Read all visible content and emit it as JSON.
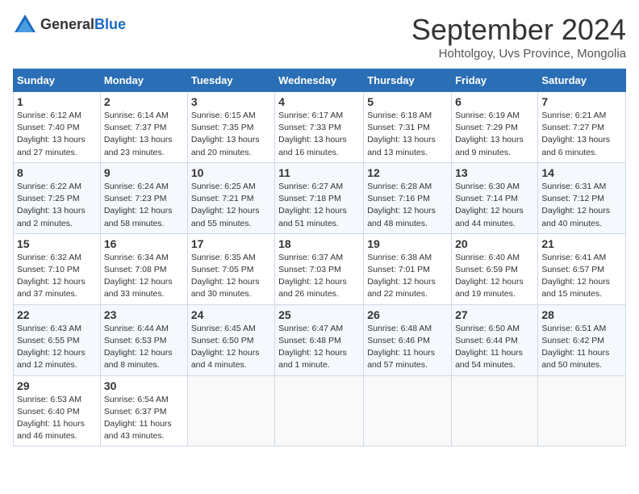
{
  "logo": {
    "general": "General",
    "blue": "Blue"
  },
  "title": "September 2024",
  "location": "Hohtolgoy, Uvs Province, Mongolia",
  "days_of_week": [
    "Sunday",
    "Monday",
    "Tuesday",
    "Wednesday",
    "Thursday",
    "Friday",
    "Saturday"
  ],
  "weeks": [
    [
      {
        "day": "1",
        "info": "Sunrise: 6:12 AM\nSunset: 7:40 PM\nDaylight: 13 hours\nand 27 minutes."
      },
      {
        "day": "2",
        "info": "Sunrise: 6:14 AM\nSunset: 7:37 PM\nDaylight: 13 hours\nand 23 minutes."
      },
      {
        "day": "3",
        "info": "Sunrise: 6:15 AM\nSunset: 7:35 PM\nDaylight: 13 hours\nand 20 minutes."
      },
      {
        "day": "4",
        "info": "Sunrise: 6:17 AM\nSunset: 7:33 PM\nDaylight: 13 hours\nand 16 minutes."
      },
      {
        "day": "5",
        "info": "Sunrise: 6:18 AM\nSunset: 7:31 PM\nDaylight: 13 hours\nand 13 minutes."
      },
      {
        "day": "6",
        "info": "Sunrise: 6:19 AM\nSunset: 7:29 PM\nDaylight: 13 hours\nand 9 minutes."
      },
      {
        "day": "7",
        "info": "Sunrise: 6:21 AM\nSunset: 7:27 PM\nDaylight: 13 hours\nand 6 minutes."
      }
    ],
    [
      {
        "day": "8",
        "info": "Sunrise: 6:22 AM\nSunset: 7:25 PM\nDaylight: 13 hours\nand 2 minutes."
      },
      {
        "day": "9",
        "info": "Sunrise: 6:24 AM\nSunset: 7:23 PM\nDaylight: 12 hours\nand 58 minutes."
      },
      {
        "day": "10",
        "info": "Sunrise: 6:25 AM\nSunset: 7:21 PM\nDaylight: 12 hours\nand 55 minutes."
      },
      {
        "day": "11",
        "info": "Sunrise: 6:27 AM\nSunset: 7:18 PM\nDaylight: 12 hours\nand 51 minutes."
      },
      {
        "day": "12",
        "info": "Sunrise: 6:28 AM\nSunset: 7:16 PM\nDaylight: 12 hours\nand 48 minutes."
      },
      {
        "day": "13",
        "info": "Sunrise: 6:30 AM\nSunset: 7:14 PM\nDaylight: 12 hours\nand 44 minutes."
      },
      {
        "day": "14",
        "info": "Sunrise: 6:31 AM\nSunset: 7:12 PM\nDaylight: 12 hours\nand 40 minutes."
      }
    ],
    [
      {
        "day": "15",
        "info": "Sunrise: 6:32 AM\nSunset: 7:10 PM\nDaylight: 12 hours\nand 37 minutes."
      },
      {
        "day": "16",
        "info": "Sunrise: 6:34 AM\nSunset: 7:08 PM\nDaylight: 12 hours\nand 33 minutes."
      },
      {
        "day": "17",
        "info": "Sunrise: 6:35 AM\nSunset: 7:05 PM\nDaylight: 12 hours\nand 30 minutes."
      },
      {
        "day": "18",
        "info": "Sunrise: 6:37 AM\nSunset: 7:03 PM\nDaylight: 12 hours\nand 26 minutes."
      },
      {
        "day": "19",
        "info": "Sunrise: 6:38 AM\nSunset: 7:01 PM\nDaylight: 12 hours\nand 22 minutes."
      },
      {
        "day": "20",
        "info": "Sunrise: 6:40 AM\nSunset: 6:59 PM\nDaylight: 12 hours\nand 19 minutes."
      },
      {
        "day": "21",
        "info": "Sunrise: 6:41 AM\nSunset: 6:57 PM\nDaylight: 12 hours\nand 15 minutes."
      }
    ],
    [
      {
        "day": "22",
        "info": "Sunrise: 6:43 AM\nSunset: 6:55 PM\nDaylight: 12 hours\nand 12 minutes."
      },
      {
        "day": "23",
        "info": "Sunrise: 6:44 AM\nSunset: 6:53 PM\nDaylight: 12 hours\nand 8 minutes."
      },
      {
        "day": "24",
        "info": "Sunrise: 6:45 AM\nSunset: 6:50 PM\nDaylight: 12 hours\nand 4 minutes."
      },
      {
        "day": "25",
        "info": "Sunrise: 6:47 AM\nSunset: 6:48 PM\nDaylight: 12 hours\nand 1 minute."
      },
      {
        "day": "26",
        "info": "Sunrise: 6:48 AM\nSunset: 6:46 PM\nDaylight: 11 hours\nand 57 minutes."
      },
      {
        "day": "27",
        "info": "Sunrise: 6:50 AM\nSunset: 6:44 PM\nDaylight: 11 hours\nand 54 minutes."
      },
      {
        "day": "28",
        "info": "Sunrise: 6:51 AM\nSunset: 6:42 PM\nDaylight: 11 hours\nand 50 minutes."
      }
    ],
    [
      {
        "day": "29",
        "info": "Sunrise: 6:53 AM\nSunset: 6:40 PM\nDaylight: 11 hours\nand 46 minutes."
      },
      {
        "day": "30",
        "info": "Sunrise: 6:54 AM\nSunset: 6:37 PM\nDaylight: 11 hours\nand 43 minutes."
      },
      {
        "day": "",
        "info": ""
      },
      {
        "day": "",
        "info": ""
      },
      {
        "day": "",
        "info": ""
      },
      {
        "day": "",
        "info": ""
      },
      {
        "day": "",
        "info": ""
      }
    ]
  ]
}
